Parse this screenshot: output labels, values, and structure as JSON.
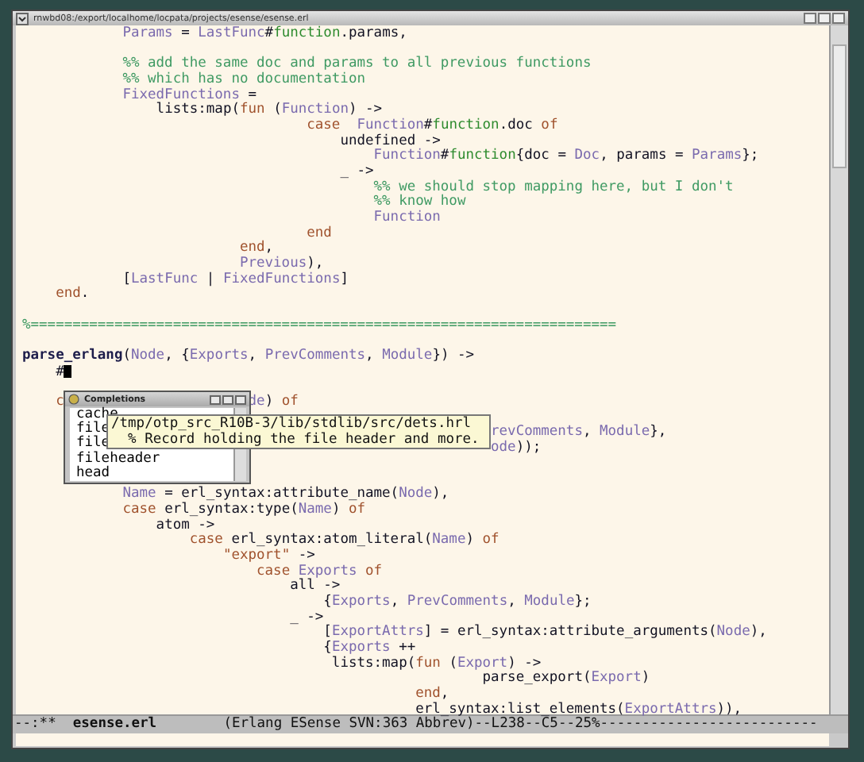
{
  "window": {
    "title": "rnwbd08:/export/localhome/locpata/projects/esense/esense.erl"
  },
  "lines": [
    {
      "kind": "code",
      "segments": [
        {
          "text": "            Params",
          "kind": "variable"
        },
        {
          "text": " = ",
          "kind": "plain"
        },
        {
          "text": "LastFunc",
          "kind": "variable"
        },
        {
          "text": "#",
          "kind": "plain"
        },
        {
          "text": "function",
          "kind": "record"
        },
        {
          "text": ".params,",
          "kind": "plain"
        }
      ]
    },
    {
      "kind": "blank"
    },
    {
      "kind": "code",
      "segments": [
        {
          "text": "            %% add the same doc and params to all previous functions",
          "kind": "comment"
        }
      ]
    },
    {
      "kind": "code",
      "segments": [
        {
          "text": "            %% which has no documentation",
          "kind": "comment"
        }
      ]
    },
    {
      "kind": "code",
      "segments": [
        {
          "text": "            FixedFunctions",
          "kind": "variable"
        },
        {
          "text": " =",
          "kind": "plain"
        }
      ]
    },
    {
      "kind": "code",
      "segments": [
        {
          "text": "                lists:map(",
          "kind": "plain"
        },
        {
          "text": "fun",
          "kind": "keyword"
        },
        {
          "text": " (",
          "kind": "plain"
        },
        {
          "text": "Function",
          "kind": "variable"
        },
        {
          "text": ") ->",
          "kind": "plain"
        }
      ]
    },
    {
      "kind": "code",
      "segments": [
        {
          "text": "                                  case",
          "kind": "keyword"
        },
        {
          "text": "  Function",
          "kind": "variable"
        },
        {
          "text": "#",
          "kind": "plain"
        },
        {
          "text": "function",
          "kind": "record"
        },
        {
          "text": ".doc ",
          "kind": "plain"
        },
        {
          "text": "of",
          "kind": "keyword"
        }
      ]
    },
    {
      "kind": "code",
      "segments": [
        {
          "text": "                                      undefined ->",
          "kind": "plain"
        }
      ]
    },
    {
      "kind": "code",
      "segments": [
        {
          "text": "                                          Function",
          "kind": "variable"
        },
        {
          "text": "#",
          "kind": "plain"
        },
        {
          "text": "function",
          "kind": "record"
        },
        {
          "text": "{doc = ",
          "kind": "plain"
        },
        {
          "text": "Doc",
          "kind": "variable"
        },
        {
          "text": ", params = ",
          "kind": "plain"
        },
        {
          "text": "Params",
          "kind": "variable"
        },
        {
          "text": "};",
          "kind": "plain"
        }
      ]
    },
    {
      "kind": "code",
      "segments": [
        {
          "text": "                                      _ ->",
          "kind": "plain"
        }
      ]
    },
    {
      "kind": "code",
      "segments": [
        {
          "text": "                                          %% we should stop mapping here, but I don't",
          "kind": "comment"
        }
      ]
    },
    {
      "kind": "code",
      "segments": [
        {
          "text": "                                          %% know how",
          "kind": "comment"
        }
      ]
    },
    {
      "kind": "code",
      "segments": [
        {
          "text": "                                          Function",
          "kind": "variable"
        }
      ]
    },
    {
      "kind": "code",
      "segments": [
        {
          "text": "                                  end",
          "kind": "keyword"
        }
      ]
    },
    {
      "kind": "code",
      "segments": [
        {
          "text": "                          end",
          "kind": "keyword"
        },
        {
          "text": ",",
          "kind": "plain"
        }
      ]
    },
    {
      "kind": "code",
      "segments": [
        {
          "text": "                          Previous",
          "kind": "variable"
        },
        {
          "text": "),",
          "kind": "plain"
        }
      ]
    },
    {
      "kind": "code",
      "segments": [
        {
          "text": "            [",
          "kind": "plain"
        },
        {
          "text": "LastFunc",
          "kind": "variable"
        },
        {
          "text": " | ",
          "kind": "plain"
        },
        {
          "text": "FixedFunctions",
          "kind": "variable"
        },
        {
          "text": "]",
          "kind": "plain"
        }
      ]
    },
    {
      "kind": "code",
      "segments": [
        {
          "text": "    end",
          "kind": "keyword"
        },
        {
          "text": ".",
          "kind": "plain"
        }
      ]
    },
    {
      "kind": "blank"
    },
    {
      "kind": "code",
      "segments": [
        {
          "text": "%======================================================================",
          "kind": "comment"
        }
      ]
    },
    {
      "kind": "blank"
    },
    {
      "kind": "code",
      "segments": [
        {
          "text": "parse_erlang",
          "kind": "function"
        },
        {
          "text": "(",
          "kind": "plain"
        },
        {
          "text": "Node",
          "kind": "variable"
        },
        {
          "text": ", {",
          "kind": "plain"
        },
        {
          "text": "Exports",
          "kind": "variable"
        },
        {
          "text": ", ",
          "kind": "plain"
        },
        {
          "text": "PrevComments",
          "kind": "variable"
        },
        {
          "text": ", ",
          "kind": "plain"
        },
        {
          "text": "Module",
          "kind": "variable"
        },
        {
          "text": "}) ->",
          "kind": "plain"
        }
      ]
    },
    {
      "kind": "code",
      "cursor": true,
      "segments": [
        {
          "text": "    #",
          "kind": "plain"
        }
      ]
    },
    {
      "kind": "blank"
    },
    {
      "kind": "code",
      "pieces": [
        [
          {
            "text": "    c",
            "kind": "keyword"
          }
        ],
        [
          {
            "text": "                      de",
            "kind": "variable"
          },
          {
            "text": ") ",
            "kind": "plain"
          },
          {
            "text": "of",
            "kind": "keyword"
          }
        ]
      ]
    },
    {
      "kind": "blank"
    },
    {
      "kind": "code",
      "pieces": [
        [
          {
            "text": "                                                        revComments",
            "kind": "variable"
          },
          {
            "text": ", ",
            "kind": "plain"
          },
          {
            "text": "Module",
            "kind": "variable"
          },
          {
            "text": "},",
            "kind": "plain"
          }
        ]
      ]
    },
    {
      "kind": "code",
      "pieces": [
        [
          {
            "text": "                                                        ode",
            "kind": "variable"
          },
          {
            "text": "));",
            "kind": "plain"
          }
        ]
      ]
    },
    {
      "kind": "blank"
    },
    {
      "kind": "blank"
    },
    {
      "kind": "code",
      "segments": [
        {
          "text": "            Name",
          "kind": "variable"
        },
        {
          "text": " = erl_syntax:attribute_name(",
          "kind": "plain"
        },
        {
          "text": "Node",
          "kind": "variable"
        },
        {
          "text": "),",
          "kind": "plain"
        }
      ]
    },
    {
      "kind": "code",
      "segments": [
        {
          "text": "            case",
          "kind": "keyword"
        },
        {
          "text": " erl_syntax:type(",
          "kind": "plain"
        },
        {
          "text": "Name",
          "kind": "variable"
        },
        {
          "text": ") ",
          "kind": "plain"
        },
        {
          "text": "of",
          "kind": "keyword"
        }
      ]
    },
    {
      "kind": "code",
      "segments": [
        {
          "text": "                atom ->",
          "kind": "plain"
        }
      ]
    },
    {
      "kind": "code",
      "segments": [
        {
          "text": "                    case",
          "kind": "keyword"
        },
        {
          "text": " erl_syntax:atom_literal(",
          "kind": "plain"
        },
        {
          "text": "Name",
          "kind": "variable"
        },
        {
          "text": ") ",
          "kind": "plain"
        },
        {
          "text": "of",
          "kind": "keyword"
        }
      ]
    },
    {
      "kind": "code",
      "segments": [
        {
          "text": "                        \"export\"",
          "kind": "string"
        },
        {
          "text": " ->",
          "kind": "plain"
        }
      ]
    },
    {
      "kind": "code",
      "segments": [
        {
          "text": "                            case",
          "kind": "keyword"
        },
        {
          "text": " Exports",
          "kind": "variable"
        },
        {
          "text": " of",
          "kind": "keyword"
        }
      ]
    },
    {
      "kind": "code",
      "segments": [
        {
          "text": "                                all ->",
          "kind": "plain"
        }
      ]
    },
    {
      "kind": "code",
      "segments": [
        {
          "text": "                                    {",
          "kind": "plain"
        },
        {
          "text": "Exports",
          "kind": "variable"
        },
        {
          "text": ", ",
          "kind": "plain"
        },
        {
          "text": "PrevComments",
          "kind": "variable"
        },
        {
          "text": ", ",
          "kind": "plain"
        },
        {
          "text": "Module",
          "kind": "variable"
        },
        {
          "text": "};",
          "kind": "plain"
        }
      ]
    },
    {
      "kind": "code",
      "segments": [
        {
          "text": "                                _ ->",
          "kind": "plain"
        }
      ]
    },
    {
      "kind": "code",
      "segments": [
        {
          "text": "                                    [",
          "kind": "plain"
        },
        {
          "text": "ExportAttrs",
          "kind": "variable"
        },
        {
          "text": "] = erl_syntax:attribute_arguments(",
          "kind": "plain"
        },
        {
          "text": "Node",
          "kind": "variable"
        },
        {
          "text": "),",
          "kind": "plain"
        }
      ]
    },
    {
      "kind": "code",
      "segments": [
        {
          "text": "                                    {",
          "kind": "plain"
        },
        {
          "text": "Exports",
          "kind": "variable"
        },
        {
          "text": " ++",
          "kind": "plain"
        }
      ]
    },
    {
      "kind": "code",
      "segments": [
        {
          "text": "                                     lists:map(",
          "kind": "plain"
        },
        {
          "text": "fun",
          "kind": "keyword"
        },
        {
          "text": " (",
          "kind": "plain"
        },
        {
          "text": "Export",
          "kind": "variable"
        },
        {
          "text": ") ->",
          "kind": "plain"
        }
      ]
    },
    {
      "kind": "code",
      "segments": [
        {
          "text": "                                                       parse_export(",
          "kind": "plain"
        },
        {
          "text": "Export",
          "kind": "variable"
        },
        {
          "text": ")",
          "kind": "plain"
        }
      ]
    },
    {
      "kind": "code",
      "segments": [
        {
          "text": "                                               end",
          "kind": "keyword"
        },
        {
          "text": ",",
          "kind": "plain"
        }
      ]
    },
    {
      "kind": "code",
      "segments": [
        {
          "text": "                                               erl_syntax:list_elements(",
          "kind": "plain"
        },
        {
          "text": "ExportAttrs",
          "kind": "variable"
        },
        {
          "text": ")),",
          "kind": "plain"
        }
      ]
    }
  ],
  "completions": {
    "title": "Completions",
    "items": [
      {
        "label": "cache",
        "selected": false
      },
      {
        "label": "file",
        "selected": false
      },
      {
        "label": "file",
        "selected": false
      },
      {
        "label": "fileheader",
        "selected": false
      },
      {
        "label": "head",
        "selected": false
      }
    ]
  },
  "tooltip": {
    "path": "/tmp/otp_src_R10B-3/lib/stdlib/src/dets.hrl",
    "doc": "  % Record holding the file header and more."
  },
  "mode_line": "--:**  **esense.erl**        (Erlang ESense SVN:363 Abbrev)--L238--C5--25%--------------------------"
}
